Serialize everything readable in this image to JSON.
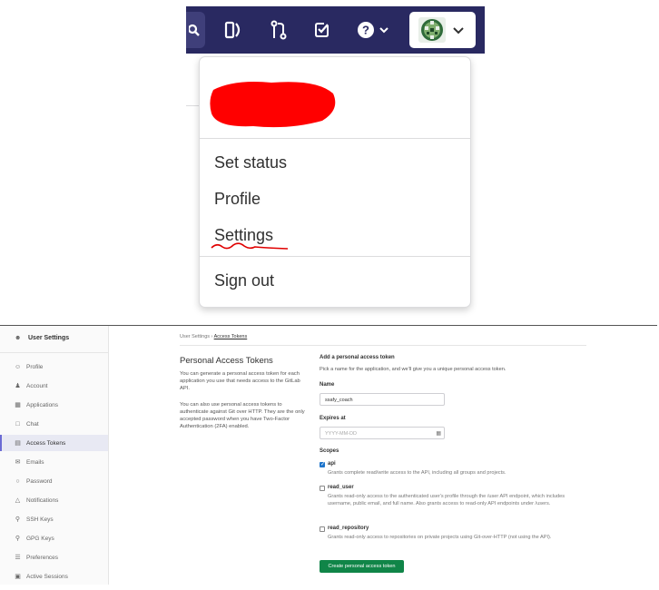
{
  "navbar": {
    "icons": [
      "search-icon",
      "merge-requests-panel-icon",
      "merge-request-icon",
      "todo-icon",
      "help-icon",
      "chevron-down-icon",
      "avatar"
    ],
    "background": "#292961"
  },
  "dropdown": {
    "items": [
      {
        "label": "Set status"
      },
      {
        "label": "Profile"
      },
      {
        "label": "Settings"
      },
      {
        "label": "Sign out"
      }
    ]
  },
  "settings_page": {
    "sidebar": {
      "header": "User Settings",
      "items": [
        {
          "label": "Profile",
          "icon": "profile-icon"
        },
        {
          "label": "Account",
          "icon": "account-icon"
        },
        {
          "label": "Applications",
          "icon": "applications-icon"
        },
        {
          "label": "Chat",
          "icon": "chat-icon"
        },
        {
          "label": "Access Tokens",
          "icon": "token-icon",
          "active": true
        },
        {
          "label": "Emails",
          "icon": "mail-icon"
        },
        {
          "label": "Password",
          "icon": "lock-icon"
        },
        {
          "label": "Notifications",
          "icon": "bell-icon"
        },
        {
          "label": "SSH Keys",
          "icon": "key-icon"
        },
        {
          "label": "GPG Keys",
          "icon": "key-icon"
        },
        {
          "label": "Preferences",
          "icon": "preferences-icon"
        },
        {
          "label": "Active Sessions",
          "icon": "sessions-icon"
        }
      ]
    },
    "breadcrumb": {
      "parent": "User Settings",
      "separator": "›",
      "current": "Access Tokens"
    },
    "left": {
      "title": "Personal Access Tokens",
      "desc1": "You can generate a personal access token for each application you use that needs access to the GitLab API.",
      "desc2": "You can also use personal access tokens to authenticate against Git over HTTP. They are the only accepted password when you have Two-Factor Authentication (2FA) enabled."
    },
    "form": {
      "heading": "Add a personal access token",
      "subheading": "Pick a name for the application, and we'll give you a unique personal access token.",
      "name_label": "Name",
      "name_value": "ssafy_coach",
      "expires_label": "Expires at",
      "expires_placeholder": "YYYY-MM-DD",
      "scopes_label": "Scopes",
      "scopes": [
        {
          "name": "api",
          "checked": true,
          "desc": "Grants complete read/write access to the API, including all groups and projects."
        },
        {
          "name": "read_user",
          "checked": false,
          "desc": "Grants read-only access to the authenticated user's profile through the /user API endpoint, which includes username, public email, and full name. Also grants access to read-only API endpoints under /users."
        },
        {
          "name": "read_repository",
          "checked": false,
          "desc": "Grants read-only access to repositories on private projects using Git-over-HTTP (not using the API)."
        }
      ],
      "submit_label": "Create personal access token"
    }
  }
}
